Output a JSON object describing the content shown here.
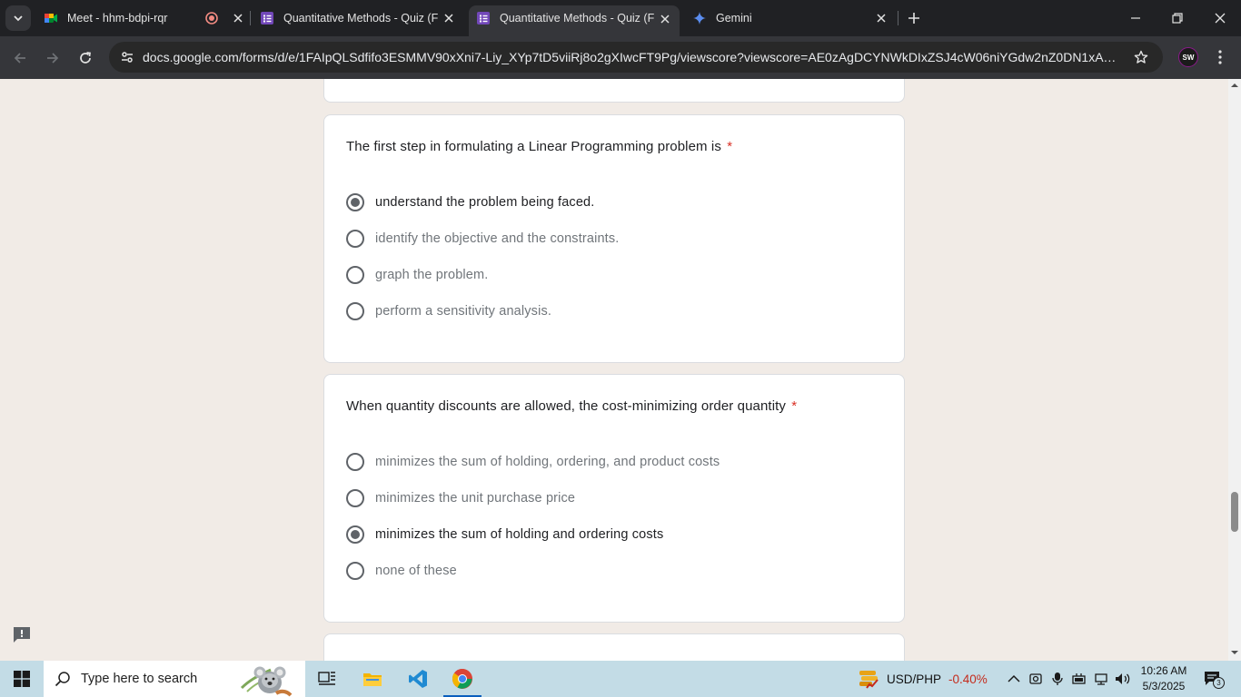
{
  "browser": {
    "tabs": [
      {
        "title": "Meet - hhm-bdpi-rqr",
        "icon": "google-meet-icon",
        "recording": true
      },
      {
        "title": "Quantitative Methods - Quiz (F",
        "icon": "google-forms-icon"
      },
      {
        "title": "Quantitative Methods - Quiz (F",
        "icon": "google-forms-icon",
        "active": true
      },
      {
        "title": "Gemini",
        "icon": "gemini-icon"
      }
    ],
    "url": "docs.google.com/forms/d/e/1FAIpQLSdfifo3ESMMV90xXni7-Liy_XYp7tD5viiRj8o2gXIwcFT9Pg/viewscore?viewscore=AE0zAgDCYNWkDIxZSJ4cW06niYGdw2nZ0DN1xAyP3sRX...",
    "profile_initials": "SW"
  },
  "questions": [
    {
      "title": "The first step in formulating a Linear Programming problem is",
      "required_mark": "*",
      "options": [
        "understand the problem being faced.",
        "identify the objective and the constraints.",
        "graph the problem.",
        "perform a sensitivity analysis."
      ],
      "selected_index": 0
    },
    {
      "title": "When quantity discounts are allowed, the cost-minimizing order quantity",
      "required_mark": "*",
      "options": [
        "minimizes the sum of holding, ordering, and product costs",
        "minimizes the unit purchase price",
        "minimizes the sum of holding and ordering costs",
        "none of these"
      ],
      "selected_index": 2
    }
  ],
  "taskbar": {
    "search_placeholder": "Type here to search",
    "ticker_pair": "USD/PHP",
    "ticker_change": "-0.40%",
    "time": "10:26 AM",
    "date": "5/3/2025",
    "notification_count": "3"
  },
  "colors": {
    "page_bg": "#f1ebe6",
    "required": "#d93025",
    "radio": "#5f6368",
    "ticker_negative": "#c42b1c"
  }
}
